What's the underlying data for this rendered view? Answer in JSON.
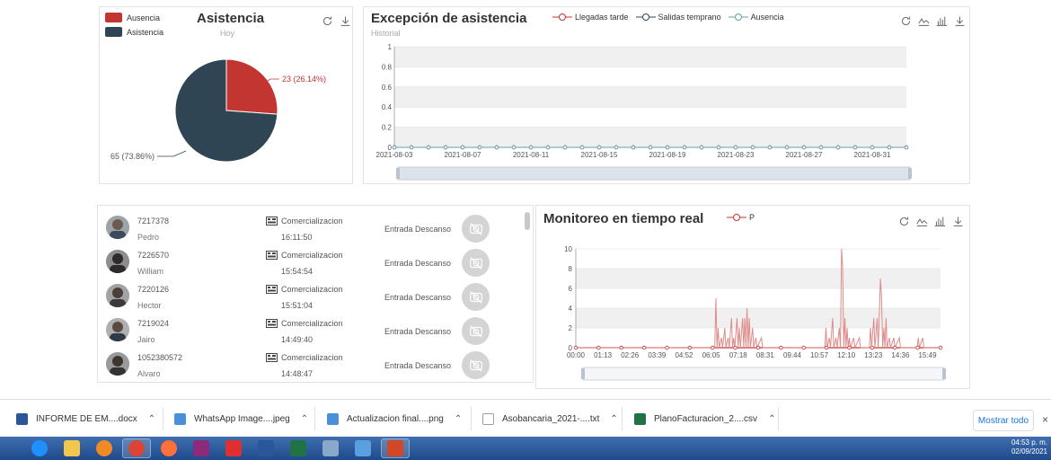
{
  "attendance_panel": {
    "title": "Asistencia",
    "subtitle": "Hoy",
    "legend": [
      {
        "label": "Ausencia",
        "color": "#c23531"
      },
      {
        "label": "Asistencia",
        "color": "#2f4554"
      }
    ],
    "slice_labels": [
      "23 (26.14%)",
      "65 (73.86%)"
    ],
    "toolbar": [
      "refresh-icon",
      "download-icon"
    ]
  },
  "exception_panel": {
    "title": "Excepción de asistencia",
    "subtitle": "Historial",
    "legend": [
      {
        "label": "Llegadas tarde",
        "color": "#c23531"
      },
      {
        "label": "Salidas temprano",
        "color": "#2f4554"
      },
      {
        "label": "Ausencia",
        "color": "#61a0a8"
      }
    ],
    "toolbar": [
      "refresh-icon",
      "line-chart-icon",
      "bar-chart-icon",
      "download-icon"
    ]
  },
  "employees": [
    {
      "id": "7217378",
      "name": "Pedro",
      "department": "Comercializacion",
      "time": "16:11:50",
      "event": "Entrada Descanso"
    },
    {
      "id": "7226570",
      "name": "William",
      "department": "Comercializacion",
      "time": "15:54:54",
      "event": "Entrada Descanso"
    },
    {
      "id": "7220126",
      "name": "Hector",
      "department": "Comercializacion",
      "time": "15:51:04",
      "event": "Entrada Descanso"
    },
    {
      "id": "7219024",
      "name": "Jairo",
      "department": "Comercializacion",
      "time": "14:49:40",
      "event": "Entrada Descanso"
    },
    {
      "id": "1052380572",
      "name": "Alvaro",
      "department": "Comercializacion",
      "time": "14:48:47",
      "event": "Entrada Descanso"
    }
  ],
  "realtime_panel": {
    "title": "Monitoreo en tiempo real",
    "legend": [
      {
        "label": "P",
        "color": "#c23531"
      }
    ],
    "toolbar": [
      "refresh-icon",
      "line-chart-icon",
      "bar-chart-icon",
      "download-icon"
    ]
  },
  "downloads": {
    "items": [
      {
        "name": "INFORME DE EM....docx",
        "icon": "word-doc-icon",
        "color": "#2b579a"
      },
      {
        "name": "WhatsApp Image....jpeg",
        "icon": "image-file-icon",
        "color": "#4a90d9"
      },
      {
        "name": "Actualizacion final....png",
        "icon": "image-file-icon",
        "color": "#4a90d9"
      },
      {
        "name": "Asobancaria_2021-....txt",
        "icon": "text-file-icon",
        "color": "#9aa0a6"
      },
      {
        "name": "PlanoFacturacion_2....csv",
        "icon": "excel-file-icon",
        "color": "#217346"
      }
    ],
    "show_all": "Mostrar todo",
    "close": "×"
  },
  "taskbar": {
    "apps": [
      {
        "icon": "ie-icon",
        "color": "#1e90ff"
      },
      {
        "icon": "folder-icon",
        "color": "#f3c74e"
      },
      {
        "icon": "media-icon",
        "color": "#f08a24"
      },
      {
        "icon": "chrome-icon",
        "color": "#db4437"
      },
      {
        "icon": "firefox-icon",
        "color": "#ff7139"
      },
      {
        "icon": "paint-icon",
        "color": "#8e2a7c"
      },
      {
        "icon": "acrobat-icon",
        "color": "#e02f2f"
      },
      {
        "icon": "word-icon",
        "color": "#2b579a"
      },
      {
        "icon": "excel-icon",
        "color": "#217346"
      },
      {
        "icon": "calculator-icon",
        "color": "#8aa9c9"
      },
      {
        "icon": "snipping-icon",
        "color": "#5aa0e0"
      },
      {
        "icon": "powerpoint-icon",
        "color": "#d24726"
      }
    ],
    "clock_time": "04:53 p. m.",
    "clock_date": "02/09/2021"
  },
  "chart_data": [
    {
      "type": "pie",
      "title": "Asistencia",
      "subtitle": "Hoy",
      "categories": [
        "Ausencia",
        "Asistencia"
      ],
      "values": [
        23,
        65
      ],
      "percentages": [
        26.14,
        73.86
      ],
      "colors": [
        "#c23531",
        "#2f4554"
      ],
      "legend": "top-left"
    },
    {
      "type": "line",
      "title": "Excepción de asistencia",
      "subtitle": "Historial",
      "x": [
        "2021-08-03",
        "2021-08-04",
        "2021-08-05",
        "2021-08-06",
        "2021-08-07",
        "2021-08-08",
        "2021-08-09",
        "2021-08-10",
        "2021-08-11",
        "2021-08-12",
        "2021-08-13",
        "2021-08-14",
        "2021-08-15",
        "2021-08-16",
        "2021-08-17",
        "2021-08-18",
        "2021-08-19",
        "2021-08-20",
        "2021-08-21",
        "2021-08-22",
        "2021-08-23",
        "2021-08-24",
        "2021-08-25",
        "2021-08-26",
        "2021-08-27",
        "2021-08-28",
        "2021-08-29",
        "2021-08-30",
        "2021-08-31",
        "2021-09-01",
        "2021-09-02"
      ],
      "x_tick_labels": [
        "2021-08-03",
        "2021-08-07",
        "2021-08-11",
        "2021-08-15",
        "2021-08-19",
        "2021-08-23",
        "2021-08-27",
        "2021-08-31"
      ],
      "y_tick_labels": [
        "0",
        "0.2",
        "0.4",
        "0.6",
        "0.8",
        "1"
      ],
      "ylim": [
        0,
        1
      ],
      "series": [
        {
          "name": "Llegadas tarde",
          "values": [
            0,
            0,
            0,
            0,
            0,
            0,
            0,
            0,
            0,
            0,
            0,
            0,
            0,
            0,
            0,
            0,
            0,
            0,
            0,
            0,
            0,
            0,
            0,
            0,
            0,
            0,
            0,
            0,
            0,
            0,
            0
          ]
        },
        {
          "name": "Salidas temprano",
          "values": [
            0,
            0,
            0,
            0,
            0,
            0,
            0,
            0,
            0,
            0,
            0,
            0,
            0,
            0,
            0,
            0,
            0,
            0,
            0,
            0,
            0,
            0,
            0,
            0,
            0,
            0,
            0,
            0,
            0,
            0,
            0
          ]
        },
        {
          "name": "Ausencia",
          "values": [
            0,
            0,
            0,
            0,
            0,
            0,
            0,
            0,
            0,
            0,
            0,
            0,
            0,
            0,
            0,
            0,
            0,
            0,
            0,
            0,
            0,
            0,
            0,
            0,
            0,
            0,
            0,
            0,
            0,
            0,
            0
          ]
        }
      ],
      "grid": true,
      "legend": "top-center"
    },
    {
      "type": "line",
      "title": "Monitoreo en tiempo real",
      "x_tick_labels": [
        "00:00",
        "01:13",
        "02:26",
        "03:39",
        "04:52",
        "06:05",
        "07:18",
        "08:31",
        "09:44",
        "10:57",
        "12:10",
        "13:23",
        "14:36",
        "15:49"
      ],
      "y_tick_labels": [
        "0",
        "2",
        "4",
        "6",
        "8",
        "10"
      ],
      "ylim": [
        0,
        10
      ],
      "x_range_hours": [
        0,
        16.4
      ],
      "series": [
        {
          "name": "P",
          "points": [
            [
              6.25,
              0
            ],
            [
              6.3,
              5
            ],
            [
              6.35,
              0
            ],
            [
              6.4,
              2
            ],
            [
              6.45,
              0
            ],
            [
              6.55,
              1
            ],
            [
              6.6,
              0
            ],
            [
              6.7,
              2
            ],
            [
              6.75,
              0
            ],
            [
              6.85,
              1
            ],
            [
              6.9,
              0
            ],
            [
              7.0,
              3
            ],
            [
              7.05,
              0
            ],
            [
              7.1,
              1
            ],
            [
              7.15,
              0
            ],
            [
              7.25,
              3
            ],
            [
              7.3,
              0
            ],
            [
              7.35,
              2
            ],
            [
              7.4,
              0
            ],
            [
              7.5,
              3
            ],
            [
              7.55,
              0
            ],
            [
              7.6,
              3
            ],
            [
              7.65,
              0
            ],
            [
              7.7,
              4
            ],
            [
              7.75,
              0
            ],
            [
              7.8,
              3
            ],
            [
              7.85,
              0
            ],
            [
              7.95,
              2
            ],
            [
              8.0,
              0
            ],
            [
              8.1,
              1
            ],
            [
              8.15,
              0
            ],
            [
              8.35,
              1
            ],
            [
              8.4,
              0
            ],
            [
              11.2,
              0
            ],
            [
              11.25,
              2
            ],
            [
              11.3,
              0
            ],
            [
              11.4,
              1
            ],
            [
              11.45,
              0
            ],
            [
              11.55,
              3
            ],
            [
              11.6,
              0
            ],
            [
              11.7,
              1
            ],
            [
              11.75,
              0
            ],
            [
              11.85,
              2
            ],
            [
              11.9,
              0
            ],
            [
              11.95,
              10
            ],
            [
              12.0,
              8
            ],
            [
              12.05,
              0
            ],
            [
              12.1,
              3
            ],
            [
              12.15,
              0
            ],
            [
              12.2,
              2
            ],
            [
              12.25,
              0
            ],
            [
              12.3,
              1
            ],
            [
              12.35,
              0
            ],
            [
              12.5,
              1
            ],
            [
              12.55,
              0
            ],
            [
              12.75,
              1
            ],
            [
              12.8,
              0
            ],
            [
              13.2,
              0
            ],
            [
              13.25,
              2
            ],
            [
              13.3,
              0
            ],
            [
              13.4,
              3
            ],
            [
              13.45,
              0
            ],
            [
              13.55,
              3
            ],
            [
              13.6,
              0
            ],
            [
              13.7,
              7
            ],
            [
              13.75,
              5
            ],
            [
              13.8,
              0
            ],
            [
              13.85,
              2
            ],
            [
              13.9,
              0
            ],
            [
              13.95,
              3
            ],
            [
              14.0,
              0
            ],
            [
              14.1,
              1
            ],
            [
              14.15,
              0
            ],
            [
              14.3,
              1
            ],
            [
              14.35,
              0
            ],
            [
              14.55,
              1
            ],
            [
              14.6,
              0
            ],
            [
              15.35,
              0
            ],
            [
              15.4,
              1
            ],
            [
              15.45,
              0
            ],
            [
              15.6,
              1
            ],
            [
              15.65,
              0
            ]
          ]
        }
      ],
      "grid": true,
      "legend": "top-center"
    }
  ]
}
